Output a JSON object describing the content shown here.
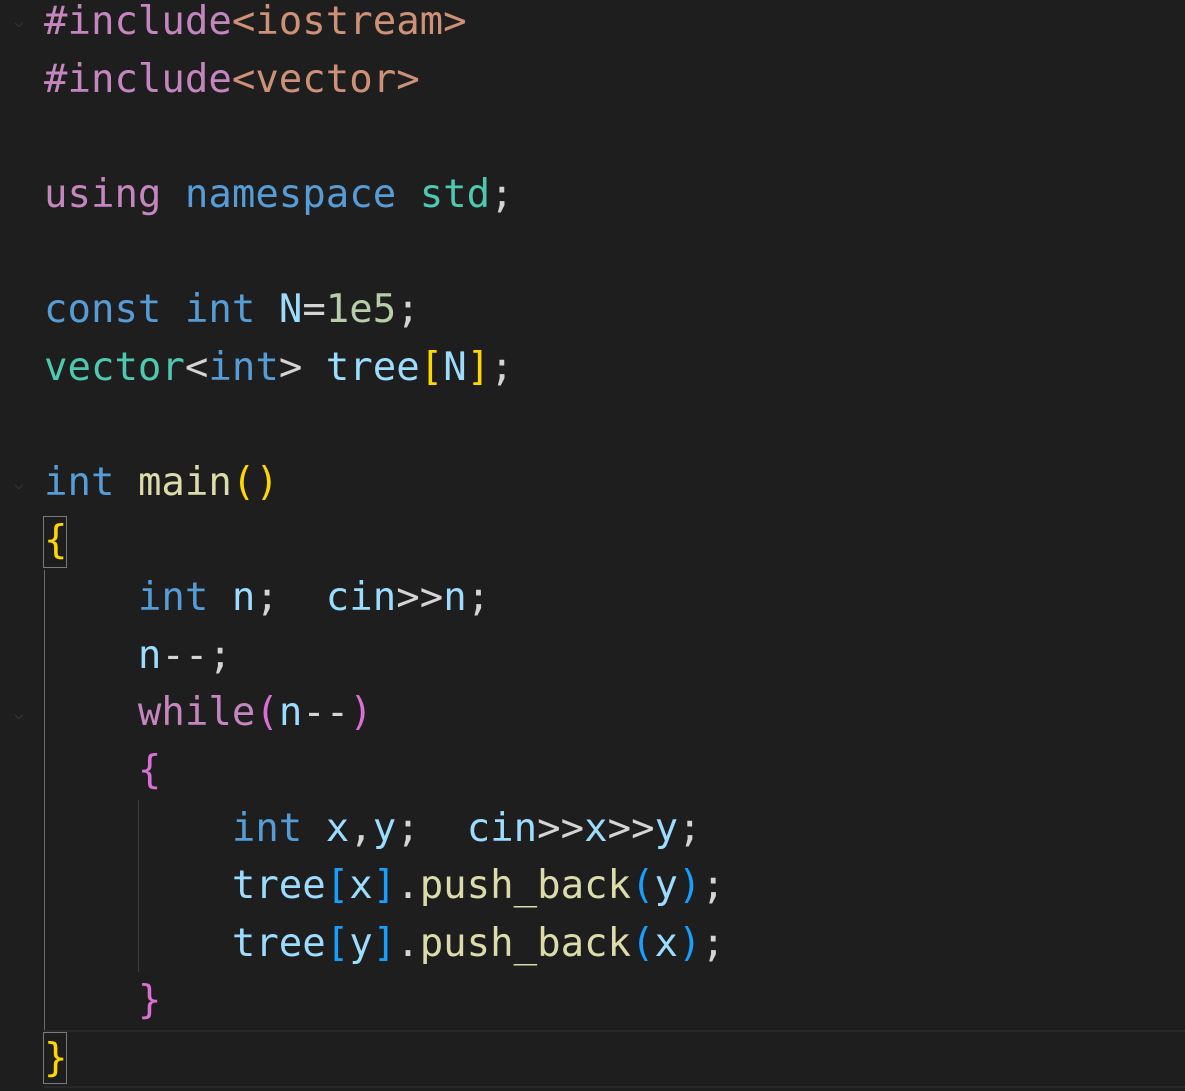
{
  "editor": {
    "colors": {
      "background": "#1e1e1e",
      "preprocessor": "#c586c0",
      "string": "#ce9178",
      "keyword": "#569cd6",
      "type": "#4ec9b0",
      "variable": "#9cdcfe",
      "function": "#dcdcaa",
      "number": "#b5cea8",
      "text": "#d4d4d4",
      "bracket_gold": "#ffd700",
      "bracket_purple": "#da70d6",
      "bracket_blue": "#179fff"
    },
    "lines": [
      {
        "tokens": [
          {
            "t": "#include",
            "c": "preprocessor"
          },
          {
            "t": "<iostream>",
            "c": "string"
          }
        ]
      },
      {
        "tokens": [
          {
            "t": "#include",
            "c": "preprocessor"
          },
          {
            "t": "<vector>",
            "c": "string"
          }
        ]
      },
      {
        "tokens": []
      },
      {
        "tokens": [
          {
            "t": "using",
            "c": "preprocessor"
          },
          {
            "t": " ",
            "c": "text"
          },
          {
            "t": "namespace",
            "c": "keyword"
          },
          {
            "t": " ",
            "c": "text"
          },
          {
            "t": "std",
            "c": "type"
          },
          {
            "t": ";",
            "c": "text"
          }
        ]
      },
      {
        "tokens": []
      },
      {
        "tokens": [
          {
            "t": "const",
            "c": "keyword"
          },
          {
            "t": " ",
            "c": "text"
          },
          {
            "t": "int",
            "c": "keyword"
          },
          {
            "t": " ",
            "c": "text"
          },
          {
            "t": "N",
            "c": "variable"
          },
          {
            "t": "=",
            "c": "text"
          },
          {
            "t": "1e5",
            "c": "number"
          },
          {
            "t": ";",
            "c": "text"
          }
        ]
      },
      {
        "tokens": [
          {
            "t": "vector",
            "c": "type"
          },
          {
            "t": "<",
            "c": "text"
          },
          {
            "t": "int",
            "c": "keyword"
          },
          {
            "t": ">",
            "c": "text"
          },
          {
            "t": " ",
            "c": "text"
          },
          {
            "t": "tree",
            "c": "variable"
          },
          {
            "t": "[",
            "c": "bracket_gold"
          },
          {
            "t": "N",
            "c": "variable"
          },
          {
            "t": "]",
            "c": "bracket_gold"
          },
          {
            "t": ";",
            "c": "text"
          }
        ]
      },
      {
        "tokens": []
      },
      {
        "tokens": [
          {
            "t": "int",
            "c": "keyword"
          },
          {
            "t": " ",
            "c": "text"
          },
          {
            "t": "main",
            "c": "function"
          },
          {
            "t": "()",
            "c": "bracket_gold"
          }
        ]
      },
      {
        "tokens": [
          {
            "t": "{",
            "c": "bracket_gold"
          }
        ]
      },
      {
        "tokens": [
          {
            "t": "    ",
            "c": "text"
          },
          {
            "t": "int",
            "c": "keyword"
          },
          {
            "t": " ",
            "c": "text"
          },
          {
            "t": "n",
            "c": "variable"
          },
          {
            "t": ";  ",
            "c": "text"
          },
          {
            "t": "cin",
            "c": "variable"
          },
          {
            "t": ">>",
            "c": "text"
          },
          {
            "t": "n",
            "c": "variable"
          },
          {
            "t": ";",
            "c": "text"
          }
        ]
      },
      {
        "tokens": [
          {
            "t": "    ",
            "c": "text"
          },
          {
            "t": "n",
            "c": "variable"
          },
          {
            "t": "--;",
            "c": "text"
          }
        ]
      },
      {
        "tokens": [
          {
            "t": "    ",
            "c": "text"
          },
          {
            "t": "while",
            "c": "preprocessor"
          },
          {
            "t": "(",
            "c": "bracket_purple"
          },
          {
            "t": "n",
            "c": "variable"
          },
          {
            "t": "--",
            "c": "text"
          },
          {
            "t": ")",
            "c": "bracket_purple"
          }
        ]
      },
      {
        "tokens": [
          {
            "t": "    ",
            "c": "text"
          },
          {
            "t": "{",
            "c": "bracket_purple"
          }
        ]
      },
      {
        "tokens": [
          {
            "t": "        ",
            "c": "text"
          },
          {
            "t": "int",
            "c": "keyword"
          },
          {
            "t": " ",
            "c": "text"
          },
          {
            "t": "x",
            "c": "variable"
          },
          {
            "t": ",",
            "c": "text"
          },
          {
            "t": "y",
            "c": "variable"
          },
          {
            "t": ";  ",
            "c": "text"
          },
          {
            "t": "cin",
            "c": "variable"
          },
          {
            "t": ">>",
            "c": "text"
          },
          {
            "t": "x",
            "c": "variable"
          },
          {
            "t": ">>",
            "c": "text"
          },
          {
            "t": "y",
            "c": "variable"
          },
          {
            "t": ";",
            "c": "text"
          }
        ]
      },
      {
        "tokens": [
          {
            "t": "        ",
            "c": "text"
          },
          {
            "t": "tree",
            "c": "variable"
          },
          {
            "t": "[",
            "c": "bracket_blue"
          },
          {
            "t": "x",
            "c": "variable"
          },
          {
            "t": "]",
            "c": "bracket_blue"
          },
          {
            "t": ".",
            "c": "text"
          },
          {
            "t": "push_back",
            "c": "function"
          },
          {
            "t": "(",
            "c": "bracket_blue"
          },
          {
            "t": "y",
            "c": "variable"
          },
          {
            "t": ")",
            "c": "bracket_blue"
          },
          {
            "t": ";",
            "c": "text"
          }
        ]
      },
      {
        "tokens": [
          {
            "t": "        ",
            "c": "text"
          },
          {
            "t": "tree",
            "c": "variable"
          },
          {
            "t": "[",
            "c": "bracket_blue"
          },
          {
            "t": "y",
            "c": "variable"
          },
          {
            "t": "]",
            "c": "bracket_blue"
          },
          {
            "t": ".",
            "c": "text"
          },
          {
            "t": "push_back",
            "c": "function"
          },
          {
            "t": "(",
            "c": "bracket_blue"
          },
          {
            "t": "x",
            "c": "variable"
          },
          {
            "t": ")",
            "c": "bracket_blue"
          },
          {
            "t": ";",
            "c": "text"
          }
        ]
      },
      {
        "tokens": [
          {
            "t": "    ",
            "c": "text"
          },
          {
            "t": "}",
            "c": "bracket_purple"
          }
        ]
      },
      {
        "tokens": [
          {
            "t": "}",
            "c": "bracket_gold"
          }
        ]
      }
    ]
  }
}
